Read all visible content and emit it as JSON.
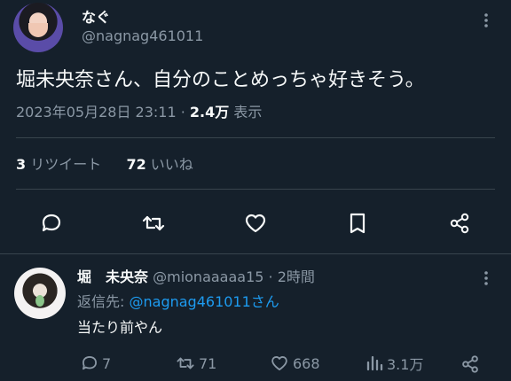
{
  "tweet": {
    "author_name": "なぐ",
    "author_handle": "@nagnag461011",
    "text": "堀未央奈さん、自分のことめっちゃ好きそう。",
    "timestamp": "2023年05月28日 23:11",
    "views_count": "2.4万",
    "views_label": "表示",
    "retweets_count": "3",
    "retweets_label": "リツイート",
    "likes_count": "72",
    "likes_label": "いいね"
  },
  "reply": {
    "author_name": "堀　未央奈",
    "author_handle": "@mionaaaaa15",
    "time_ago": "· 2時間",
    "reply_to_label": "返信先:",
    "reply_to_handle": "@nagnag461011さん",
    "text": "当たり前やん",
    "stats": {
      "replies": "7",
      "retweets": "71",
      "likes": "668",
      "views": "3.1万"
    }
  },
  "icons": {
    "more": "more-icon",
    "reply": "reply-icon",
    "retweet": "retweet-icon",
    "like": "like-icon",
    "bookmark": "bookmark-icon",
    "share": "share-icon",
    "views": "views-icon"
  },
  "colors": {
    "background": "#15202b",
    "text": "#f7f9f9",
    "muted": "#8b98a5",
    "link": "#1d9bf0",
    "divider": "#38444d"
  }
}
